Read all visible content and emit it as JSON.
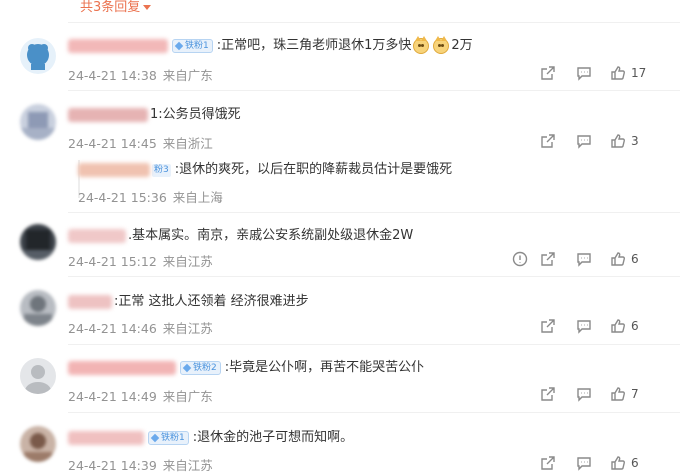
{
  "replies_toggle": {
    "label": "共3条回复"
  },
  "comments": [
    {
      "badge": "铁粉1",
      "text": ":正常吧，珠三角老师退休1万多快",
      "text_tail": "2万",
      "time": "24-4-21 14:38",
      "location": "来自广东",
      "like_count": "17",
      "avatar_color": "#4a90c8"
    },
    {
      "text": "1:公务员得饿死",
      "time": "24-4-21 14:45",
      "location": "来自浙江",
      "like_count": "3",
      "avatar_color": "#9aa7bd",
      "sub_reply": {
        "badge": "粉3",
        "text": ":退休的爽死，以后在职的降薪裁员估计是要饿死",
        "time": "24-4-21 15:36",
        "location": "来自上海"
      }
    },
    {
      "text": ".基本属实。南京，亲戚公安系统副处级退休金2W",
      "time": "24-4-21 15:12",
      "location": "来自江苏",
      "like_count": "6",
      "avatar_color": "#2e3338"
    },
    {
      "text": ":正常 这批人还领着 经济很难进步",
      "time": "24-4-21 14:46",
      "location": "来自江苏",
      "like_count": "6",
      "avatar_color": "#8d9196"
    },
    {
      "badge": "铁粉2",
      "text": ":毕竟是公仆啊，再苦不能哭苦公仆",
      "time": "24-4-21 14:49",
      "location": "来自广东",
      "like_count": "7",
      "avatar_color": "#b9bcc0"
    },
    {
      "badge": "铁粉1",
      "text": ":退休金的池子可想而知啊。",
      "time": "24-4-21 14:39",
      "location": "来自江苏",
      "like_count": "6",
      "avatar_color": "#7a5a4a"
    }
  ]
}
